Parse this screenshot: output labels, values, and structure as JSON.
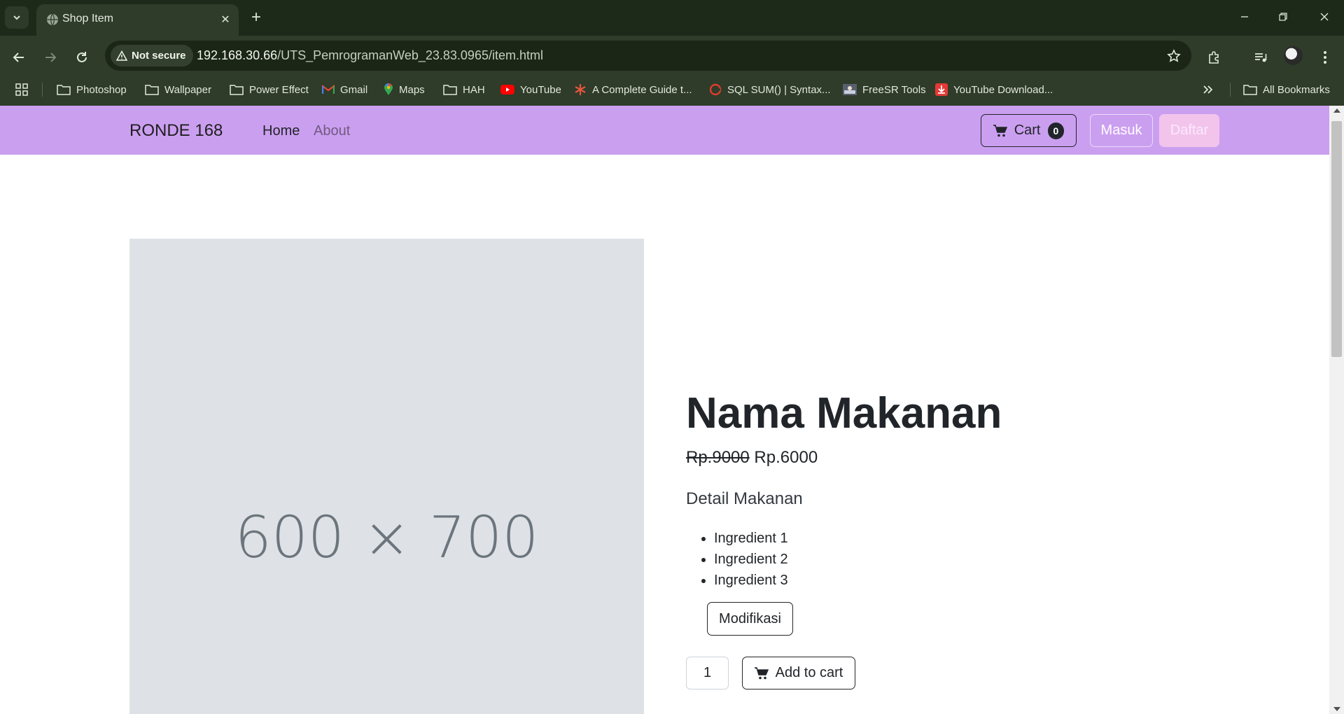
{
  "browser": {
    "tab_title": "Shop Item",
    "security_label": "Not secure",
    "url_host": "192.168.30.66",
    "url_path": "/UTS_PemrogramanWeb_23.83.0965/item.html",
    "bookmarks": [
      {
        "label": "Photoshop",
        "icon": "folder-icon"
      },
      {
        "label": "Wallpaper",
        "icon": "folder-icon"
      },
      {
        "label": "Power Effect",
        "icon": "folder-icon"
      },
      {
        "label": "Gmail",
        "icon": "gmail-icon"
      },
      {
        "label": "Maps",
        "icon": "maps-icon"
      },
      {
        "label": "HAH",
        "icon": "folder-icon"
      },
      {
        "label": "YouTube",
        "icon": "youtube-icon"
      },
      {
        "label": "A Complete Guide t...",
        "icon": "asterisk-icon"
      },
      {
        "label": "SQL SUM() | Syntax...",
        "icon": "sql-icon"
      },
      {
        "label": "FreeSR Tools",
        "icon": "freesr-icon"
      },
      {
        "label": "YouTube Download...",
        "icon": "download-icon"
      }
    ],
    "all_bookmarks": "All Bookmarks"
  },
  "navbar": {
    "brand": "RONDE 168",
    "links": [
      "Home",
      "About"
    ],
    "cart_label": "Cart",
    "cart_count": "0",
    "login_label": "Masuk",
    "register_label": "Daftar"
  },
  "product": {
    "image_placeholder": "600 × 700",
    "name": "Nama Makanan",
    "old_price": "Rp.9000",
    "new_price": "Rp.6000",
    "detail_title": "Detail Makanan",
    "ingredients": [
      "Ingredient 1",
      "Ingredient 2",
      "Ingredient 3"
    ],
    "modify_label": "Modifikasi",
    "quantity": "1",
    "add_to_cart_label": "Add to cart"
  },
  "colors": {
    "navbar_bg": "#cb9ff0",
    "register_bg": "#f2c4ec",
    "chrome_bg": "#2e3c29",
    "placeholder_bg": "#dee2e6"
  }
}
